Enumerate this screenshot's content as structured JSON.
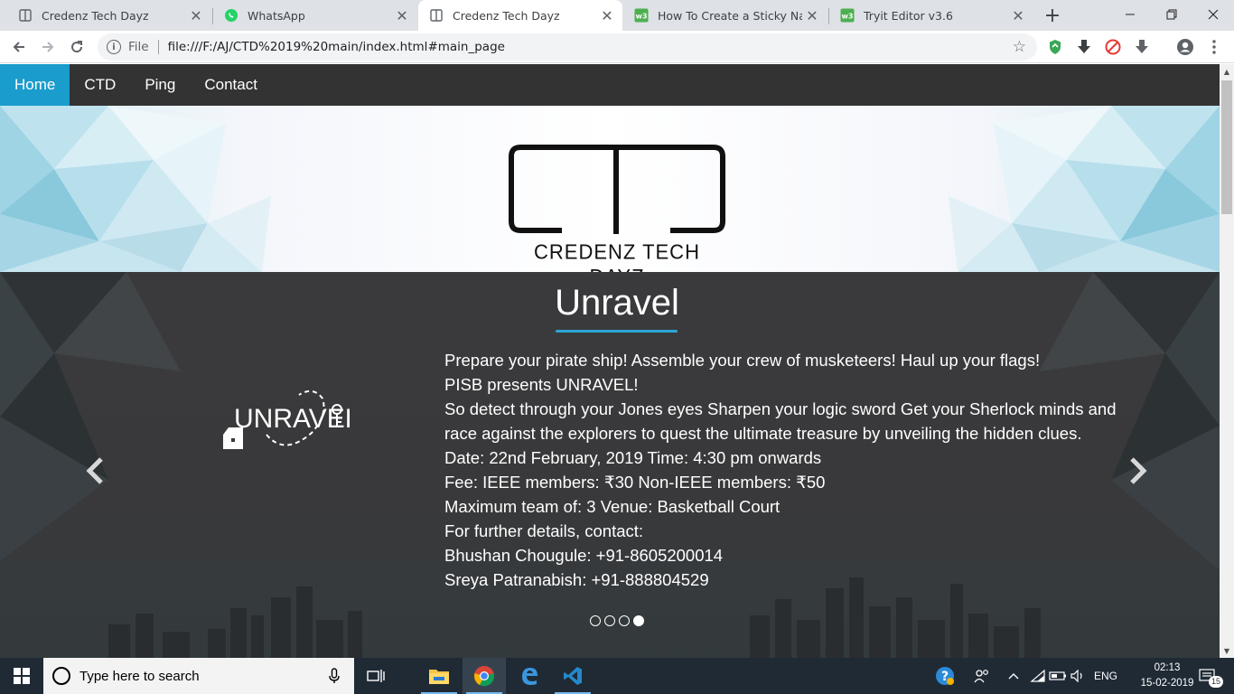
{
  "browser": {
    "tabs": [
      {
        "title": "Credenz Tech Dayz",
        "favicon": "page-icon",
        "active": false
      },
      {
        "title": "WhatsApp",
        "favicon": "whatsapp-icon",
        "active": false
      },
      {
        "title": "Credenz Tech Dayz",
        "favicon": "page-icon",
        "active": true
      },
      {
        "title": "How To Create a Sticky Navbar",
        "favicon": "w3schools-icon",
        "active": false
      },
      {
        "title": "Tryit Editor v3.6",
        "favicon": "w3schools-icon",
        "active": false
      }
    ],
    "address": {
      "scheme_label": "File",
      "url": "file:///F:/AJ/CTD%2019%20main/index.html#main_page"
    }
  },
  "site": {
    "nav": [
      {
        "label": "Home",
        "active": true
      },
      {
        "label": "CTD",
        "active": false
      },
      {
        "label": "Ping",
        "active": false
      },
      {
        "label": "Contact",
        "active": false
      }
    ],
    "logo": {
      "mark": "CTD",
      "tagline": "CREDENZ TECH DAYZ"
    },
    "carousel": {
      "title": "Unravel",
      "event_logo_text": "UNRAVEL",
      "lines": [
        "Prepare your pirate ship! Assemble your crew of musketeers! Haul up your flags!",
        "PISB presents UNRAVEL!",
        "So detect through your Jones eyes Sharpen your logic sword Get your Sherlock minds and race against the explorers to quest the ultimate treasure by unveiling the hidden clues.",
        "Date: 22nd February, 2019 Time: 4:30 pm onwards",
        "Fee: IEEE members: ₹30 Non-IEEE members: ₹50",
        "Maximum team of: 3 Venue: Basketball Court",
        "For further details, contact:",
        "Bhushan Chougule: +91-8605200014",
        "Sreya Patranabish: +91-888804529"
      ],
      "slide_count": 4,
      "active_slide": 4
    }
  },
  "taskbar": {
    "search_placeholder": "Type here to search",
    "language": "ENG",
    "time": "02:13",
    "date": "15-02-2019",
    "notification_count": "15"
  },
  "colors": {
    "nav_bg": "#333333",
    "nav_active": "#1a9ccc",
    "accent_underline": "#2aa6d6",
    "taskbar_bg": "#1f2a35"
  }
}
